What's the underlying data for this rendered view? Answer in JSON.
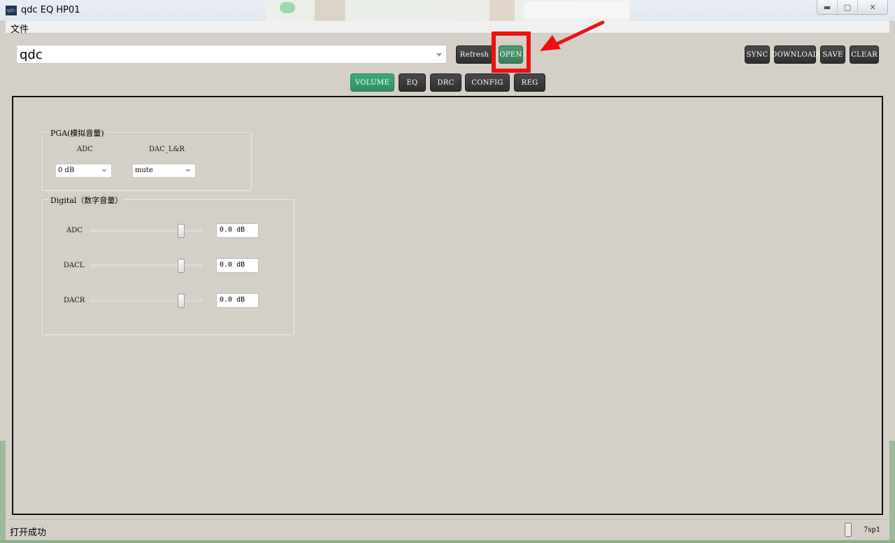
{
  "window": {
    "title": "qdc EQ HP01",
    "icon_text": "qdc",
    "minimize_glyph": "▬",
    "maximize_glyph": "□",
    "close_glyph": "✕"
  },
  "menu": {
    "file": "文件"
  },
  "toolbar": {
    "device_value": "qdc",
    "refresh": "Refresh",
    "open": "OPEN",
    "sync": "SYNC",
    "download": "DOWNLOAD",
    "save": "SAVE",
    "clear": "CLEAR"
  },
  "tabs": [
    {
      "label": "VOLUME",
      "active": true
    },
    {
      "label": "EQ",
      "active": false
    },
    {
      "label": "DRC",
      "active": false
    },
    {
      "label": "CONFIG",
      "active": false
    },
    {
      "label": "REG",
      "active": false
    }
  ],
  "pga": {
    "title": "PGA(模拟音量)",
    "adc_label": "ADC",
    "dac_label": "DAC_L&R",
    "adc_value": "0 dB",
    "dac_value": "mute"
  },
  "digital": {
    "title": "Digital（数字音量）",
    "sliders": [
      {
        "label": "ADC",
        "value": "0.0 dB",
        "level": 0.81
      },
      {
        "label": "DACL",
        "value": "0.0 dB",
        "level": 0.81
      },
      {
        "label": "DACR",
        "value": "0.0 dB",
        "level": 0.81
      }
    ]
  },
  "status": {
    "message": "打开成功",
    "right": "7sp1"
  },
  "colors": {
    "accent_green": "#3fae7c",
    "highlight_red": "#ee1111",
    "button_dark": "#3a3a3a"
  }
}
